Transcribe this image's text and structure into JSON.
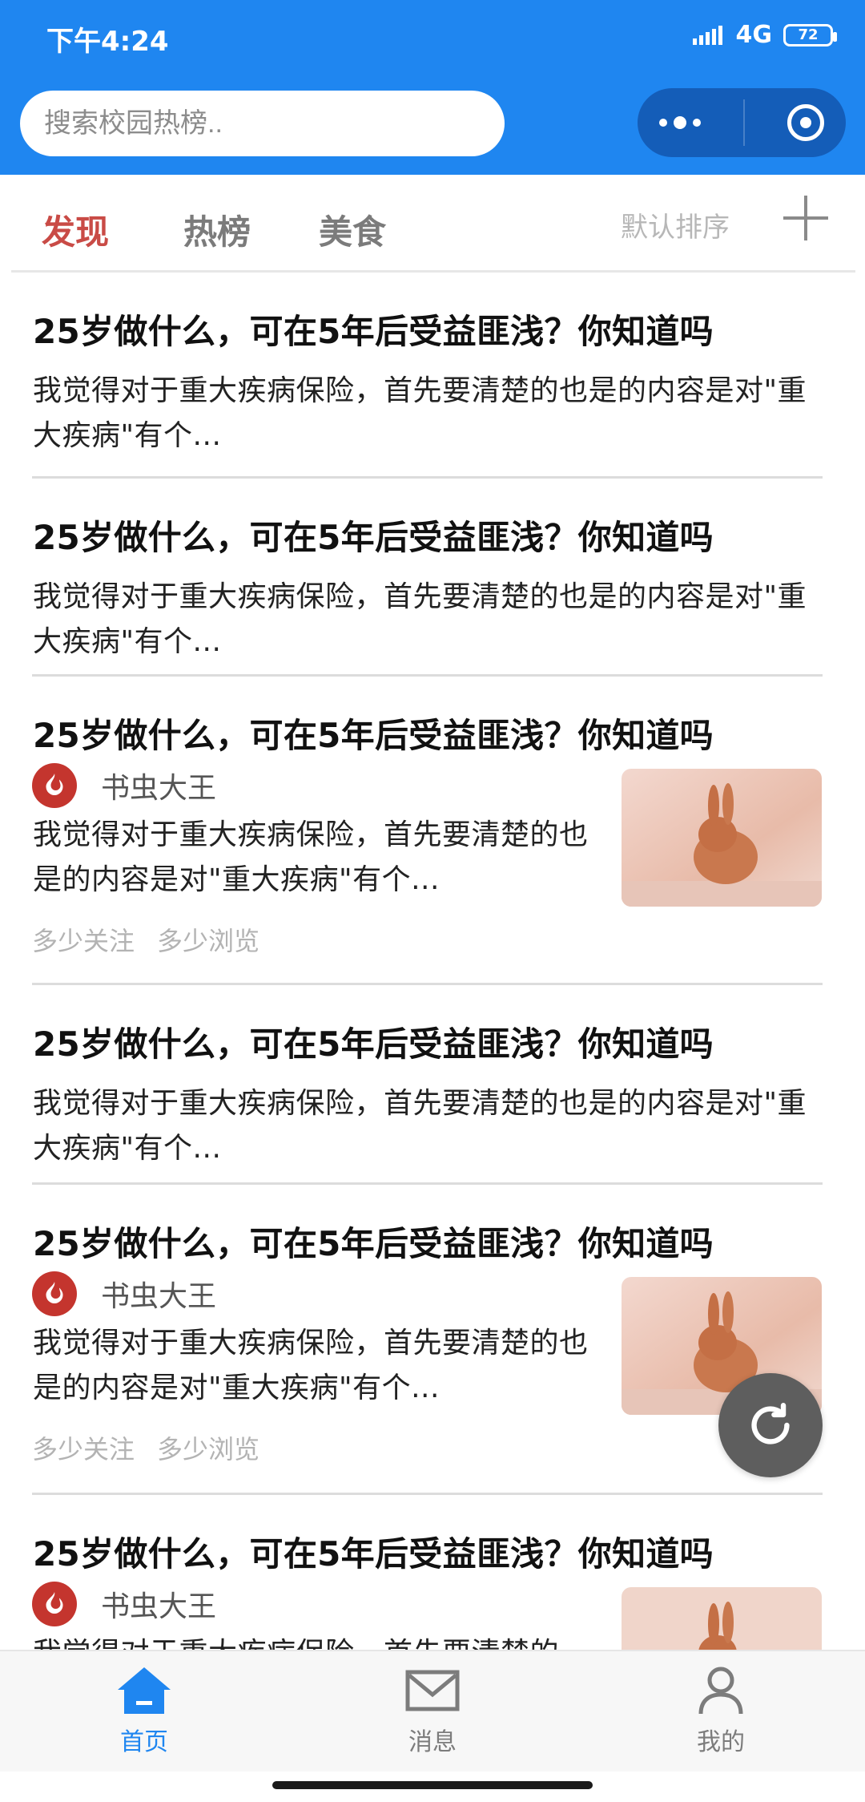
{
  "status_bar": {
    "time": "下午4:24",
    "network": "4G",
    "battery": "72"
  },
  "search": {
    "placeholder": "搜索校园热榜.."
  },
  "tabs": [
    {
      "label": "发现",
      "active": true
    },
    {
      "label": "热榜",
      "active": false
    },
    {
      "label": "美食",
      "active": false
    }
  ],
  "sort_label": "默认排序",
  "feed": {
    "items": [
      {
        "title": "25岁做什么，可在5年后受益匪浅？你知道吗",
        "body": "我觉得对于重大疾病保险，首先要清楚的也是的内容是对\"重大疾病\"有个..."
      },
      {
        "title": "25岁做什么，可在5年后受益匪浅？你知道吗",
        "body": "我觉得对于重大疾病保险，首先要清楚的也是的内容是对\"重大疾病\"有个..."
      },
      {
        "title": "25岁做什么，可在5年后受益匪浅？你知道吗",
        "author": "书虫大王",
        "body": "我觉得对于重大疾病保险，首先要清楚的也是的内容是对\"重大疾病\"有个...",
        "follows": "多少关注",
        "views": "多少浏览"
      },
      {
        "title": "25岁做什么，可在5年后受益匪浅？你知道吗",
        "body": "我觉得对于重大疾病保险，首先要清楚的也是的内容是对\"重大疾病\"有个..."
      },
      {
        "title": "25岁做什么，可在5年后受益匪浅？你知道吗",
        "author": "书虫大王",
        "body": "我觉得对于重大疾病保险，首先要清楚的也是的内容是对\"重大疾病\"有个...",
        "follows": "多少关注",
        "views": "多少浏览"
      },
      {
        "title": "25岁做什么，可在5年后受益匪浅？你知道吗",
        "author": "书虫大王",
        "body": "我觉得对于重大疾病保险，首先要清楚的"
      }
    ]
  },
  "bottom_nav": [
    {
      "label": "首页",
      "icon": "home-icon",
      "active": true
    },
    {
      "label": "消息",
      "icon": "mail-icon",
      "active": false
    },
    {
      "label": "我的",
      "icon": "user-icon",
      "active": false
    }
  ],
  "colors": {
    "brand_blue": "#1f86f0",
    "accent_red": "#c94b46",
    "fire_red": "#c4352e"
  }
}
